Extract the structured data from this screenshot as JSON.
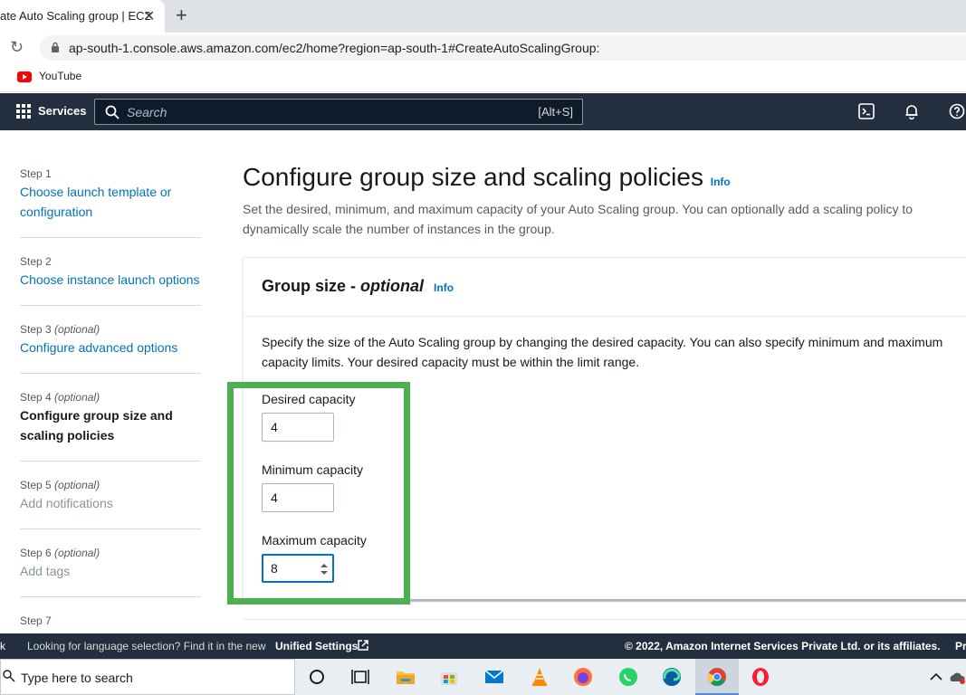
{
  "browser": {
    "tab_title": "ate Auto Scaling group | EC2",
    "url": "ap-south-1.console.aws.amazon.com/ec2/home?region=ap-south-1#CreateAutoScalingGroup:",
    "bookmark_youtube": "YouTube"
  },
  "aws_nav": {
    "services_label": "Services",
    "search_placeholder": "Search",
    "search_shortcut": "[Alt+S]"
  },
  "steps": [
    {
      "label": "Step 1",
      "optional": "",
      "title": "Choose launch template or configuration",
      "state": "link"
    },
    {
      "label": "Step 2",
      "optional": "",
      "title": "Choose instance launch options",
      "state": "link"
    },
    {
      "label": "Step 3",
      "optional": "(optional)",
      "title": "Configure advanced options",
      "state": "link"
    },
    {
      "label": "Step 4",
      "optional": "(optional)",
      "title": "Configure group size and scaling policies",
      "state": "current"
    },
    {
      "label": "Step 5",
      "optional": "(optional)",
      "title": "Add notifications",
      "state": "disabled"
    },
    {
      "label": "Step 6",
      "optional": "(optional)",
      "title": "Add tags",
      "state": "disabled"
    },
    {
      "label": "Step 7",
      "optional": "",
      "title": "",
      "state": "disabled"
    }
  ],
  "main": {
    "title": "Configure group size and scaling policies",
    "info_label": "Info",
    "description": "Set the desired, minimum, and maximum capacity of your Auto Scaling group. You can optionally add a scaling policy to dynamically scale the number of instances in the group."
  },
  "group_size": {
    "title": "Group size -",
    "title_optional": "optional",
    "info_label": "Info",
    "description": "Specify the size of the Auto Scaling group by changing the desired capacity. You can also specify minimum and maximum capacity limits. Your desired capacity must be within the limit range.",
    "desired_label": "Desired capacity",
    "desired_value": "4",
    "minimum_label": "Minimum capacity",
    "minimum_value": "4",
    "maximum_label": "Maximum capacity",
    "maximum_value": "8"
  },
  "footer": {
    "left_cut": "k",
    "language_text": "Looking for language selection? Find it in the new",
    "unified_settings": "Unified Settings",
    "copyright": "© 2022, Amazon Internet Services Private Ltd. or its affiliates.",
    "privacy_cut": "Pr"
  },
  "taskbar": {
    "search_text": "Type here to search"
  },
  "colors": {
    "aws_nav_bg": "#232f3e",
    "link": "#0073bb",
    "highlight": "#4caf50"
  }
}
